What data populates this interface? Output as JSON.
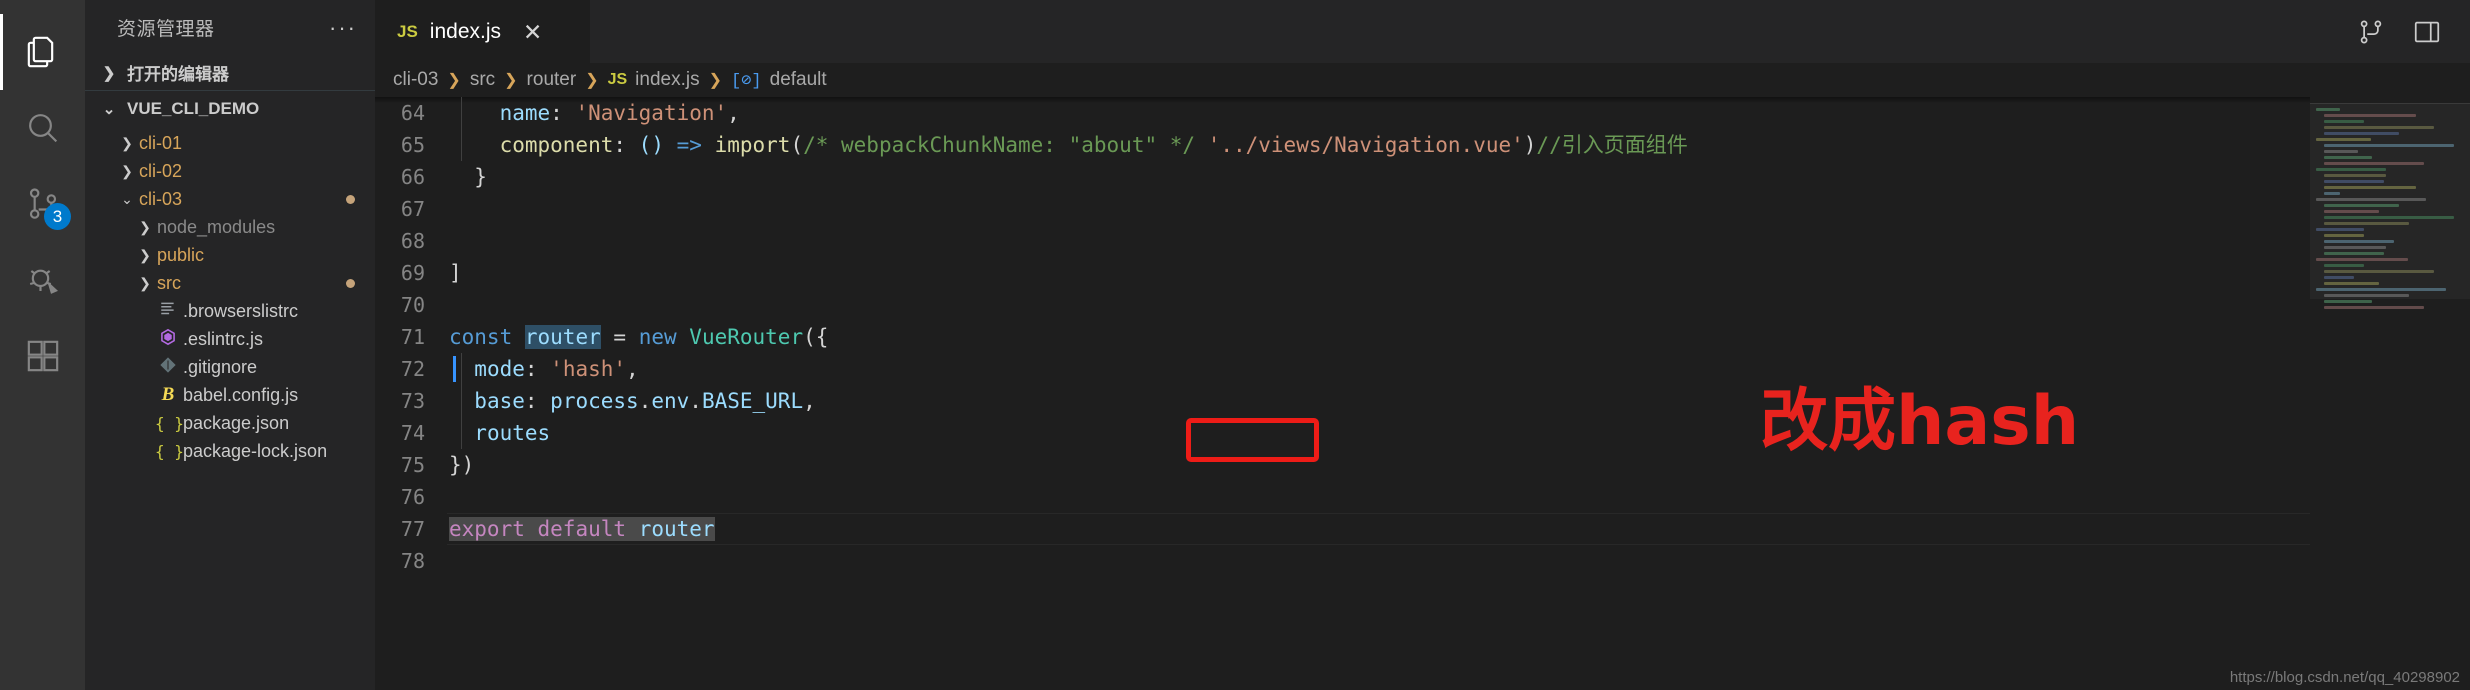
{
  "activitybar": {
    "items": [
      {
        "name": "explorer",
        "icon": "files-icon",
        "active": true,
        "badge": ""
      },
      {
        "name": "search",
        "icon": "search-icon",
        "active": false,
        "badge": ""
      },
      {
        "name": "source-control",
        "icon": "source-control-icon",
        "active": false,
        "badge": "3"
      },
      {
        "name": "run-and-debug",
        "icon": "debug-icon",
        "active": false,
        "badge": ""
      },
      {
        "name": "extensions",
        "icon": "extensions-icon",
        "active": false,
        "badge": ""
      }
    ]
  },
  "sidebar": {
    "title": "资源管理器",
    "more_actions": "···",
    "open_editors_label": "打开的编辑器",
    "project_label": "VUE_CLI_DEMO",
    "tree": [
      {
        "label": "cli-01",
        "type": "folder",
        "expanded": false,
        "indent": 1,
        "modified": false,
        "dim": false
      },
      {
        "label": "cli-02",
        "type": "folder",
        "expanded": false,
        "indent": 1,
        "modified": false,
        "dim": false
      },
      {
        "label": "cli-03",
        "type": "folder",
        "expanded": true,
        "indent": 1,
        "modified": true,
        "dim": false
      },
      {
        "label": "node_modules",
        "type": "folder",
        "expanded": false,
        "indent": 2,
        "modified": false,
        "dim": true
      },
      {
        "label": "public",
        "type": "folder",
        "expanded": false,
        "indent": 2,
        "modified": false,
        "dim": false
      },
      {
        "label": "src",
        "type": "folder",
        "expanded": false,
        "indent": 2,
        "modified": true,
        "dim": false
      },
      {
        "label": ".browserslistrc",
        "type": "file",
        "icon": "config-lines-icon",
        "indent": 2,
        "color": "#9aa0a6"
      },
      {
        "label": ".eslintrc.js",
        "type": "file",
        "icon": "eslint-icon",
        "indent": 2,
        "color": "#b36ae2"
      },
      {
        "label": ".gitignore",
        "type": "file",
        "icon": "git-icon",
        "indent": 2,
        "color": "#6d8086"
      },
      {
        "label": "babel.config.js",
        "type": "file",
        "icon": "babel-icon",
        "indent": 2,
        "color": "#f5da55"
      },
      {
        "label": "package.json",
        "type": "file",
        "icon": "json-icon",
        "indent": 2,
        "color": "#cbcb41"
      },
      {
        "label": "package-lock.json",
        "type": "file",
        "icon": "json-icon",
        "indent": 2,
        "color": "#cbcb41"
      }
    ]
  },
  "tabs": [
    {
      "label": "index.js",
      "icon": "js-icon",
      "icon_text": "JS",
      "active": true,
      "close": "✕"
    }
  ],
  "editor_actions": [
    {
      "name": "split-editor-icon"
    },
    {
      "name": "toggle-panel-icon"
    }
  ],
  "breadcrumb": [
    {
      "label": "cli-03",
      "icon": ""
    },
    {
      "label": "src",
      "icon": ""
    },
    {
      "label": "router",
      "icon": ""
    },
    {
      "label": "index.js",
      "icon": "js-icon",
      "icon_text": "JS"
    },
    {
      "label": "default",
      "icon": "symbol-icon",
      "icon_text": "[⊘]"
    }
  ],
  "breadcrumb_separator": "❯",
  "code": {
    "first_line_number": 64,
    "lines": [
      {
        "n": 64,
        "tokens": [
          {
            "t": "    ",
            "c": "t-plain"
          },
          {
            "t": "name",
            "c": "t-var"
          },
          {
            "t": ": ",
            "c": "t-plain"
          },
          {
            "t": "'Navigation'",
            "c": "t-str"
          },
          {
            "t": ",",
            "c": "t-plain"
          }
        ]
      },
      {
        "n": 65,
        "tokens": [
          {
            "t": "    ",
            "c": "t-plain"
          },
          {
            "t": "component",
            "c": "t-fn"
          },
          {
            "t": ": ",
            "c": "t-plain"
          },
          {
            "t": "()",
            "c": "t-var"
          },
          {
            "t": " ",
            "c": "t-plain"
          },
          {
            "t": "=>",
            "c": "t-key"
          },
          {
            "t": " ",
            "c": "t-plain"
          },
          {
            "t": "import",
            "c": "t-fn"
          },
          {
            "t": "(",
            "c": "t-plain"
          },
          {
            "t": "/* webpackChunkName: \"about\" */",
            "c": "t-com"
          },
          {
            "t": " ",
            "c": "t-plain"
          },
          {
            "t": "'../views/Navigation.vue'",
            "c": "t-str"
          },
          {
            "t": ")",
            "c": "t-plain"
          },
          {
            "t": "//引入页面组件",
            "c": "t-com"
          }
        ]
      },
      {
        "n": 66,
        "tokens": [
          {
            "t": "  }",
            "c": "t-plain"
          }
        ]
      },
      {
        "n": 67,
        "tokens": []
      },
      {
        "n": 68,
        "tokens": []
      },
      {
        "n": 69,
        "tokens": [
          {
            "t": "]",
            "c": "t-plain"
          }
        ]
      },
      {
        "n": 70,
        "tokens": []
      },
      {
        "n": 71,
        "tokens": [
          {
            "t": "const",
            "c": "t-key"
          },
          {
            "t": " ",
            "c": "t-plain"
          },
          {
            "t": "router",
            "c": "t-var hl-word"
          },
          {
            "t": " ",
            "c": "t-plain"
          },
          {
            "t": "=",
            "c": "t-op"
          },
          {
            "t": " ",
            "c": "t-plain"
          },
          {
            "t": "new",
            "c": "t-key"
          },
          {
            "t": " ",
            "c": "t-plain"
          },
          {
            "t": "VueRouter",
            "c": "t-cls"
          },
          {
            "t": "({",
            "c": "t-plain"
          }
        ]
      },
      {
        "n": 72,
        "tokens": [
          {
            "t": "  ",
            "c": "t-plain"
          },
          {
            "t": "mode",
            "c": "t-var"
          },
          {
            "t": ": ",
            "c": "t-plain"
          },
          {
            "t": "'hash'",
            "c": "t-str"
          },
          {
            "t": ",",
            "c": "t-plain"
          }
        ]
      },
      {
        "n": 73,
        "tokens": [
          {
            "t": "  ",
            "c": "t-plain"
          },
          {
            "t": "base",
            "c": "t-var"
          },
          {
            "t": ": ",
            "c": "t-plain"
          },
          {
            "t": "process",
            "c": "t-var"
          },
          {
            "t": ".",
            "c": "t-plain"
          },
          {
            "t": "env",
            "c": "t-var"
          },
          {
            "t": ".",
            "c": "t-plain"
          },
          {
            "t": "BASE_URL",
            "c": "t-var"
          },
          {
            "t": ",",
            "c": "t-plain"
          }
        ]
      },
      {
        "n": 74,
        "tokens": [
          {
            "t": "  ",
            "c": "t-plain"
          },
          {
            "t": "routes",
            "c": "t-var"
          }
        ]
      },
      {
        "n": 75,
        "tokens": [
          {
            "t": "})",
            "c": "t-plain"
          }
        ]
      },
      {
        "n": 76,
        "tokens": []
      },
      {
        "n": 77,
        "tokens": [
          {
            "t": "export",
            "c": "t-kw2 hl-sel"
          },
          {
            "t": " ",
            "c": "t-plain hl-sel"
          },
          {
            "t": "default",
            "c": "t-kw2 hl-sel"
          },
          {
            "t": " ",
            "c": "t-plain hl-sel"
          },
          {
            "t": "router",
            "c": "t-var hl-sel"
          }
        ]
      },
      {
        "n": 78,
        "tokens": []
      }
    ]
  },
  "annotation": {
    "text": "改成hash",
    "color": "#e8231e",
    "box_target": "'hash'"
  },
  "watermark": "https://blog.csdn.net/qq_40298902",
  "colors": {
    "accent": "#007acc",
    "annotation_red": "#ee1c17",
    "editor_bg": "#1e1e1e",
    "sidebar_bg": "#252526",
    "activitybar_bg": "#333333"
  }
}
